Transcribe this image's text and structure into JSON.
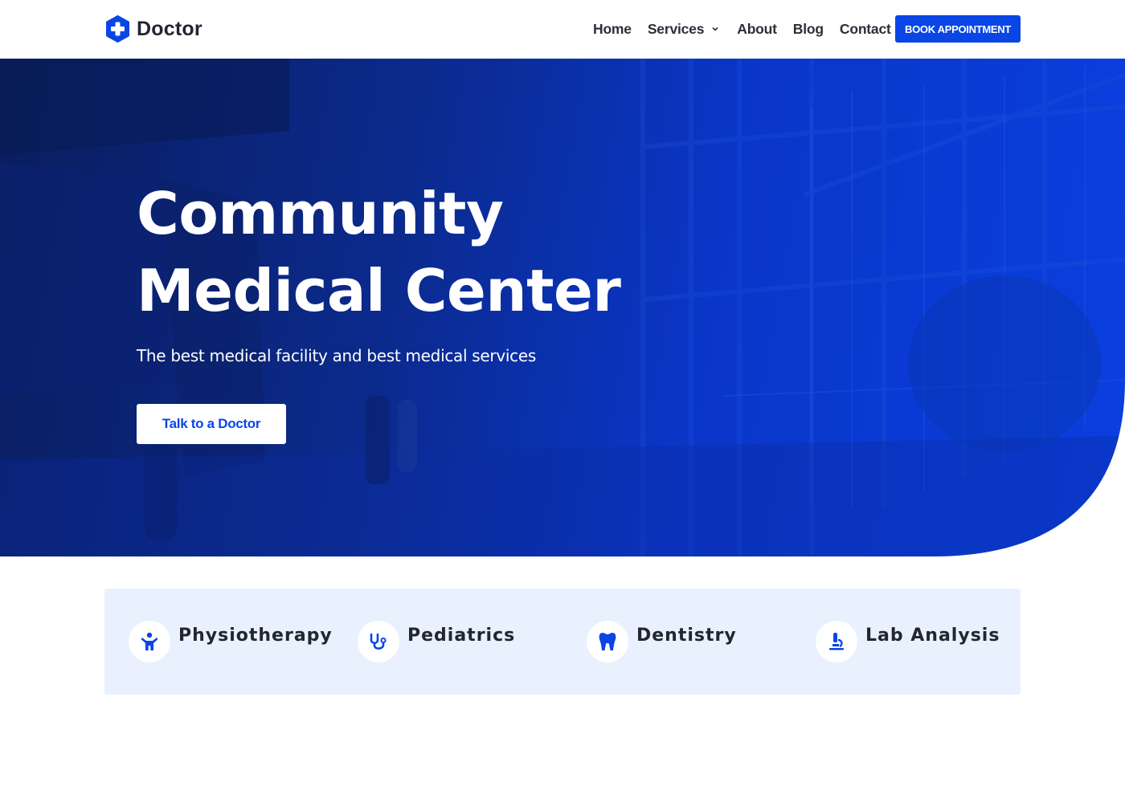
{
  "header": {
    "logo_text": "Doctor",
    "nav": [
      {
        "label": "Home"
      },
      {
        "label": "Services",
        "has_dropdown": true
      },
      {
        "label": "About"
      },
      {
        "label": "Blog"
      },
      {
        "label": "Contact"
      }
    ],
    "cta_label": "BOOK APPOINTMENT"
  },
  "hero": {
    "title_line1": "Community",
    "title_line2": "Medical Center",
    "subtitle": "The best medical facility and best medical services",
    "button_label": "Talk to a Doctor"
  },
  "services": [
    {
      "label": "Physiotherapy",
      "icon": "child-icon"
    },
    {
      "label": "Pediatrics",
      "icon": "stethoscope-icon"
    },
    {
      "label": "Dentistry",
      "icon": "tooth-icon"
    },
    {
      "label": "Lab Analysis",
      "icon": "microscope-icon"
    }
  ],
  "colors": {
    "brand": "#0a46e6",
    "hero_dark": "#0a1d5e",
    "services_bg": "#e8f1fd",
    "text_dark": "#22262e"
  }
}
